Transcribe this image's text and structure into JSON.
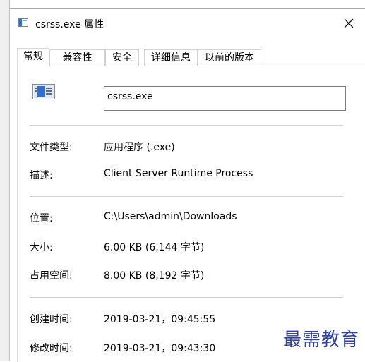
{
  "window": {
    "title": "csrss.exe 属性",
    "close_symbol": "✕"
  },
  "tabs": [
    {
      "label": "常规",
      "active": true
    },
    {
      "label": "兼容性",
      "active": false
    },
    {
      "label": "安全",
      "active": false
    },
    {
      "label": "详细信息",
      "active": false
    },
    {
      "label": "以前的版本",
      "active": false
    }
  ],
  "general": {
    "filename": "csrss.exe",
    "file_type_label": "文件类型:",
    "file_type_value": "应用程序 (.exe)",
    "description_label": "描述:",
    "description_value": "Client Server Runtime Process",
    "location_label": "位置:",
    "location_value": "C:\\Users\\admin\\Downloads",
    "size_label": "大小:",
    "size_value": "6.00 KB (6,144 字节)",
    "size_on_disk_label": "占用空间:",
    "size_on_disk_value": "8.00 KB (8,192 字节)",
    "created_label": "创建时间:",
    "created_value": "2019-03-21，09:45:55",
    "modified_label": "修改时间:",
    "modified_value": "2019-03-21，09:43:30"
  },
  "watermark": "最需教育",
  "colors": {
    "accent_blue": "#2e6fd6",
    "watermark": "#2d3fa8"
  }
}
